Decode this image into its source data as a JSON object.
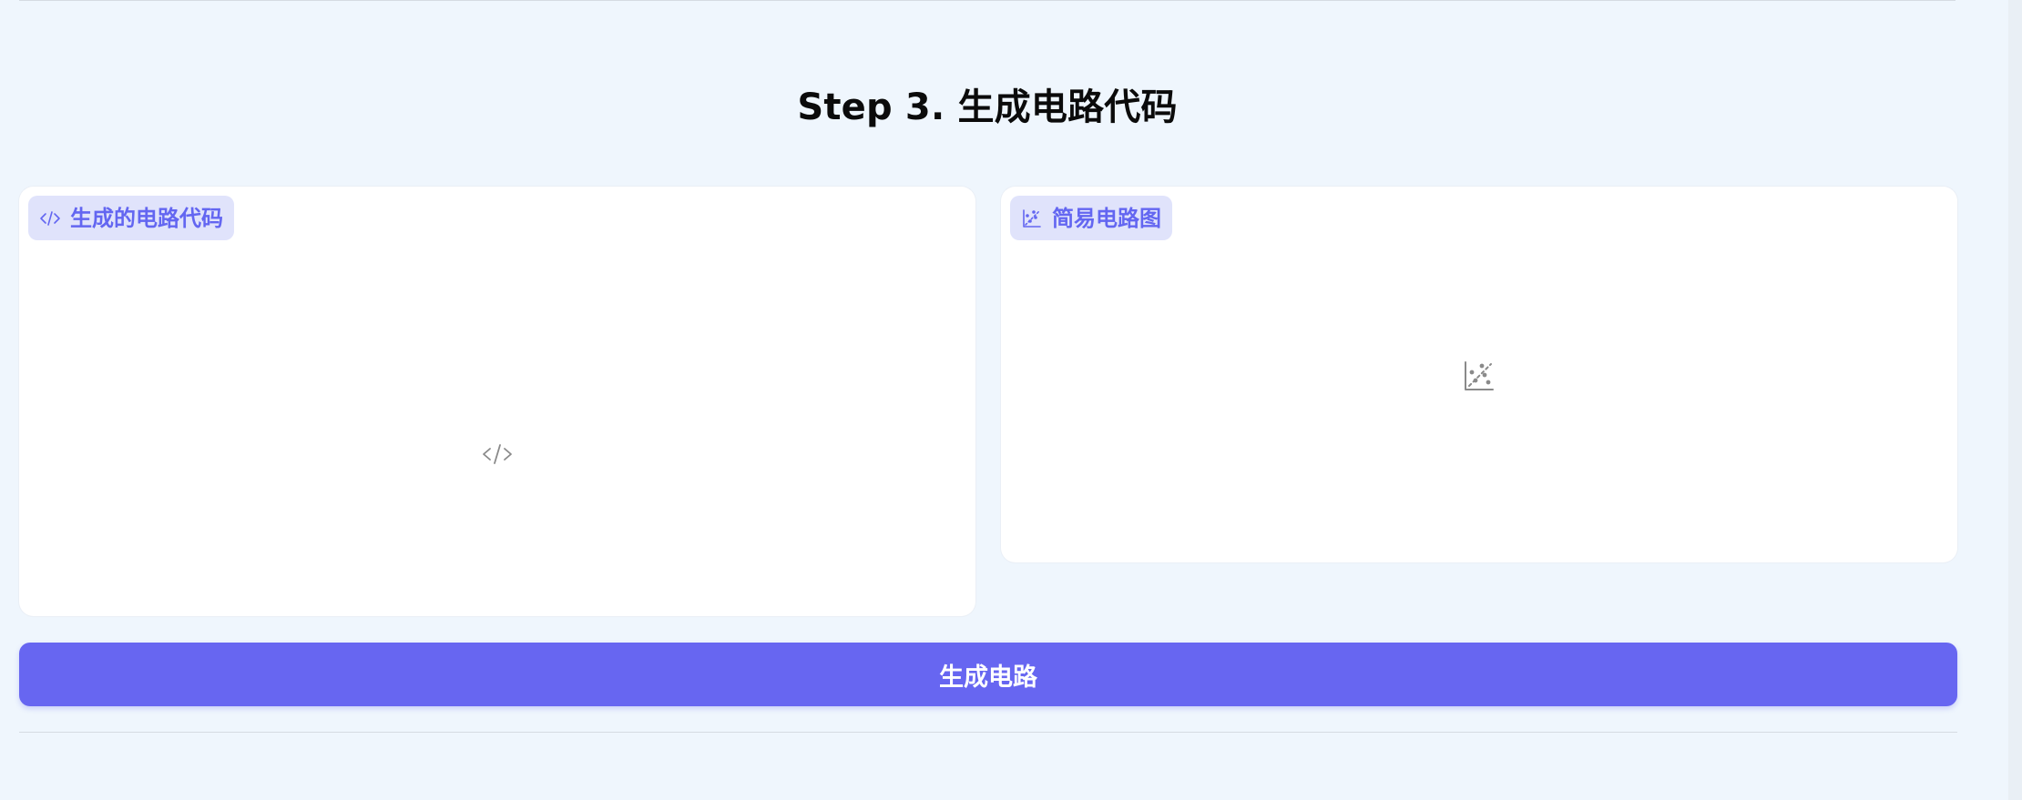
{
  "step": {
    "title": "Step 3. 生成电路代码"
  },
  "panels": {
    "code": {
      "tag_label": "生成的电路代码",
      "tag_icon": "code-icon",
      "placeholder_icon": "code-icon"
    },
    "diagram": {
      "tag_label": "简易电路图",
      "tag_icon": "scatter-chart-icon",
      "placeholder_icon": "scatter-chart-icon"
    }
  },
  "actions": {
    "generate_label": "生成电路"
  },
  "colors": {
    "background": "#eff6fd",
    "accent": "#6366f1",
    "tag_background": "#e0e3fb",
    "panel_background": "#ffffff",
    "placeholder_icon": "#8a8a8a"
  }
}
